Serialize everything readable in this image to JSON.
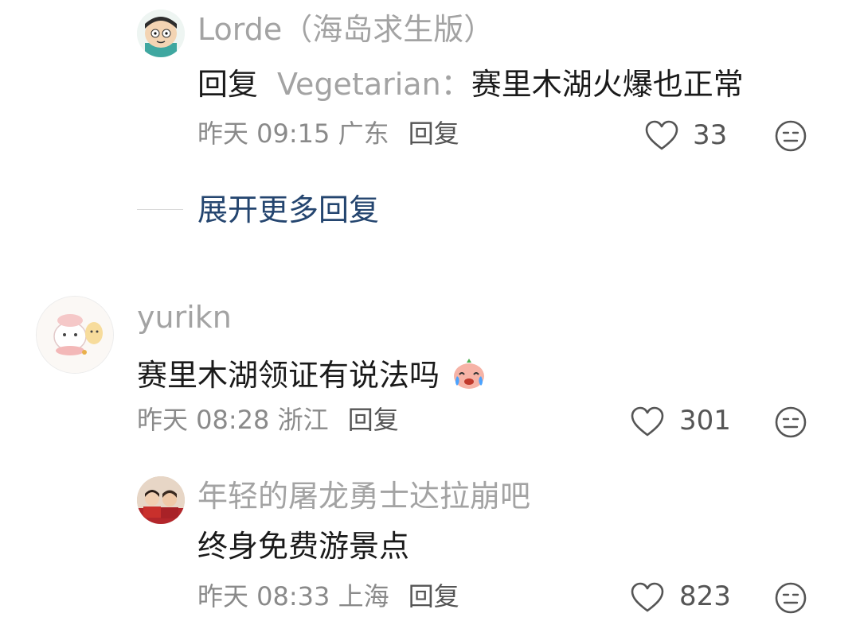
{
  "comments": [
    {
      "username": "Lorde（海岛求生版）",
      "reply_prefix": "回复",
      "reply_target": "Vegetarian：",
      "text": "赛里木湖火爆也正常",
      "time": "昨天 09:15",
      "location": "广东",
      "reply_label": "回复",
      "likes": "33"
    },
    {
      "expand_label": "展开更多回复"
    },
    {
      "username": "yurikn",
      "text": "赛里木湖领证有说法吗",
      "time": "昨天 08:28",
      "location": "浙江",
      "reply_label": "回复",
      "likes": "301"
    },
    {
      "username": "年轻的屠龙勇士达拉崩吧",
      "text": "终身免费游景点",
      "time": "昨天 08:33",
      "location": "上海",
      "reply_label": "回复",
      "likes": "823"
    }
  ],
  "colors": {
    "username": "#a3a3a3",
    "meta": "#8a8a8a",
    "expand_link": "#24456f"
  },
  "icons": [
    "heart-outline-icon",
    "dislike-face-icon",
    "crying-face-emoji"
  ]
}
